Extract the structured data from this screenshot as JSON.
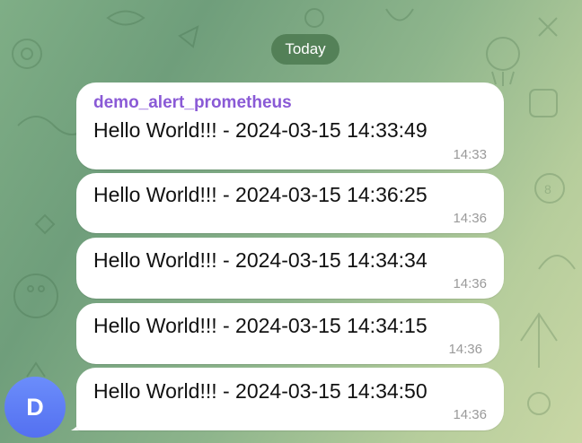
{
  "chat": {
    "date_separator": "Today",
    "sender_name": "demo_alert_prometheus",
    "avatar_letter": "D",
    "messages": [
      {
        "text": "Hello World!!! - 2024-03-15 14:33:49",
        "time": "14:33"
      },
      {
        "text": "Hello World!!! - 2024-03-15 14:36:25",
        "time": "14:36"
      },
      {
        "text": "Hello World!!! - 2024-03-15 14:34:34",
        "time": "14:36"
      },
      {
        "text": "Hello World!!! - 2024-03-15 14:34:15",
        "time": "14:36"
      },
      {
        "text": "Hello World!!! - 2024-03-15 14:34:50",
        "time": "14:36"
      }
    ]
  },
  "colors": {
    "sender_name": "#8a5ad6",
    "avatar": "#5b79f5",
    "date_pill": "#4a784e",
    "bubble": "#ffffff"
  },
  "icons": [
    "chat-background-doodles",
    "bubble-tail"
  ]
}
